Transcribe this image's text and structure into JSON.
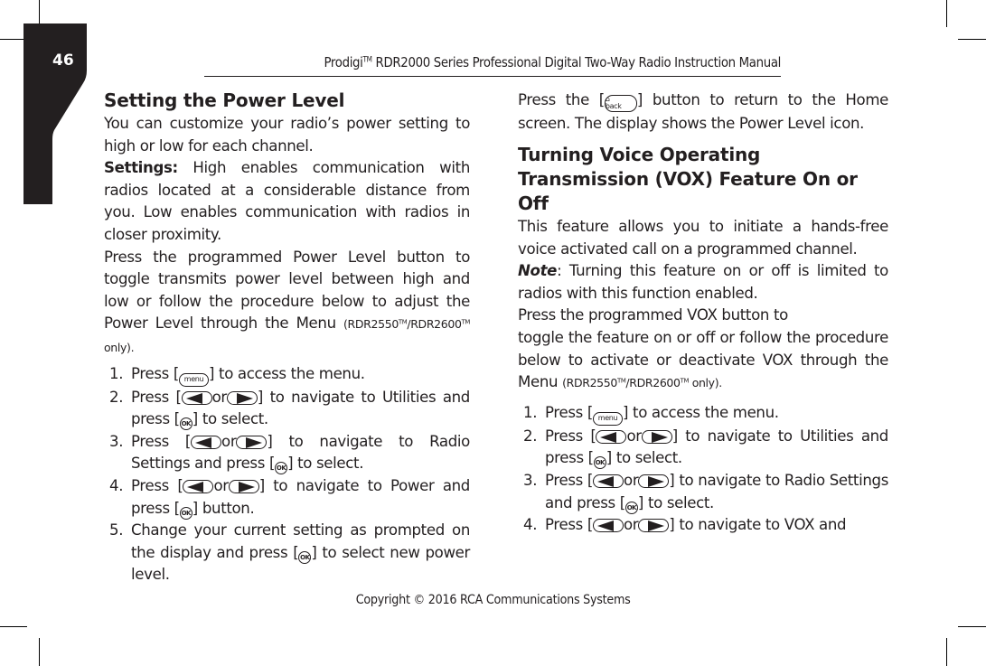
{
  "page": {
    "number": "46",
    "header": {
      "brand": "Prodigi",
      "brand_tm": "TM",
      "title": " RDR2000 Series Professional Digital Two-Way Radio Instruction Manual"
    },
    "footer": "Copyright © 2016 RCA Communications Systems"
  },
  "icons": {
    "menu_label": "menu",
    "ok_label": "OK",
    "back_label": "back",
    "back_home": "⌂",
    "bracket_open": "[",
    "bracket_close": "]",
    "or": "or"
  },
  "power": {
    "heading": "Setting the Power Level",
    "intro": "You can customize your radio’s power setting to high or low for each channel.",
    "settings_label": "Settings:",
    "settings_text": " High enables communication with radios located at a considerable distance from you. Low enables communication with radios in closer proximity.",
    "press_text": "Press the programmed Power Level button to toggle transmits power level between high and low or follow the procedure below to adjust the Power Level through the Menu ",
    "models": {
      "open": "(RDR2550",
      "tm": "TM",
      "mid": "/RDR2600",
      "close": " only)."
    },
    "steps": [
      {
        "num": "1.",
        "pre": "Press ",
        "post": " to access the menu."
      },
      {
        "num": "2.",
        "pre": "Press ",
        "post": " to navigate to Utilities and press ",
        "post2": " to select."
      },
      {
        "num": "3.",
        "pre": "Press ",
        "post": " to navigate to Radio Settings and press ",
        "post2": " to select."
      },
      {
        "num": "4.",
        "pre": "Press ",
        "post": " to navigate to Power and press ",
        "post2": " button."
      },
      {
        "num": "5.",
        "pre": "Change your current setting as prompted on the display and press ",
        "post": " to select new power level."
      }
    ]
  },
  "return_text": {
    "pre": "Press the ",
    "post": " button to return to the Home screen. The display shows the Power Level icon."
  },
  "vox": {
    "heading": "Turning Voice Operating Transmission (VOX) Feature On or Off",
    "intro": "This feature allows you to initiate a hands-free voice activated call on a programmed channel.",
    "note_label": "Note",
    "note_text": ": Turning this feature on or off is limited to radios with this function enabled.",
    "press_line1": "Press the programmed VOX button to",
    "press_text": "toggle the feature on or off or follow the procedure below to activate or deactivate VOX through the Menu ",
    "models": {
      "open": "(RDR2550",
      "tm": "TM",
      "mid": "/RDR2600",
      "close": "only)."
    },
    "steps": [
      {
        "num": "1.",
        "pre": "Press ",
        "post": " to access the menu."
      },
      {
        "num": "2.",
        "pre": "Press ",
        "post": " to navigate to Utilities and press ",
        "post2": " to select."
      },
      {
        "num": "3.",
        "pre": "Press ",
        "post": " to navigate to Radio Settings and press ",
        "post2": " to select."
      },
      {
        "num": "4.",
        "pre": "Press ",
        "post": " to navigate to VOX and"
      }
    ]
  }
}
